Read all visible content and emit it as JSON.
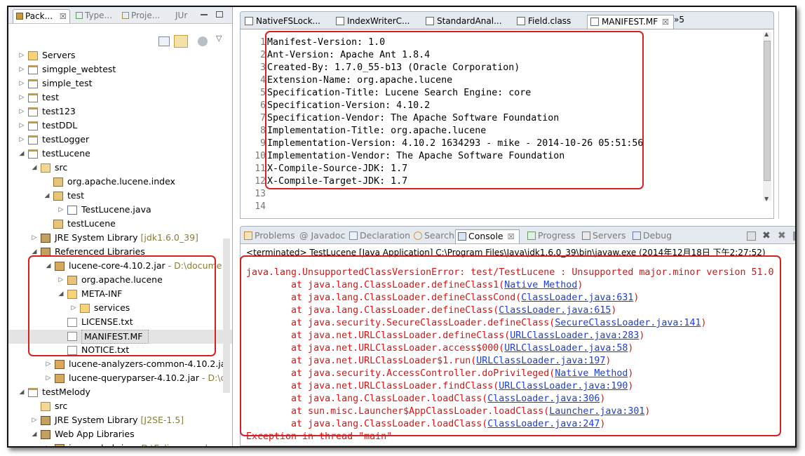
{
  "left_panel": {
    "tabs": [
      {
        "label": "Pack...",
        "close": "☒"
      },
      {
        "label": "Type...",
        "close": ""
      },
      {
        "label": "Proje...",
        "close": ""
      },
      {
        "label": "JUr",
        "close": ""
      }
    ],
    "tree": [
      {
        "label": "Servers",
        "decoration": "",
        "arrow": "▷",
        "icon": "folder-icon"
      },
      {
        "label": "simgple_webtest",
        "decoration": "",
        "arrow": "▷",
        "icon": "project-icon"
      },
      {
        "label": "simple_test",
        "decoration": "",
        "arrow": "▷",
        "icon": "project-icon"
      },
      {
        "label": "test",
        "decoration": "",
        "arrow": "▷",
        "icon": "project-icon"
      },
      {
        "label": "test123",
        "decoration": "",
        "arrow": "▷",
        "icon": "project-icon"
      },
      {
        "label": "testDDL",
        "decoration": "",
        "arrow": "▷",
        "icon": "project-icon"
      },
      {
        "label": "testLogger",
        "decoration": "",
        "arrow": "▷",
        "icon": "project-icon"
      },
      {
        "label": "testLucene",
        "decoration": "",
        "arrow": "◢",
        "icon": "project-icon"
      },
      {
        "label": "src",
        "decoration": "",
        "arrow": "◢",
        "icon": "source-folder-icon"
      },
      {
        "label": "org.apache.lucene.index",
        "decoration": "",
        "arrow": "",
        "icon": "package-icon"
      },
      {
        "label": "test",
        "decoration": "",
        "arrow": "◢",
        "icon": "package-icon"
      },
      {
        "label": "TestLucene.java",
        "decoration": "",
        "arrow": "▷",
        "icon": "java-file-icon"
      },
      {
        "label": "testLucene",
        "decoration": "",
        "arrow": "",
        "icon": "package-icon"
      },
      {
        "label": "JRE System Library",
        "decoration": "[jdk1.6.0_39]",
        "arrow": "▷",
        "icon": "library-icon"
      },
      {
        "label": "Referenced Libraries",
        "decoration": "",
        "arrow": "◢",
        "icon": "library-icon"
      },
      {
        "label": "lucene-core-4.10.2.jar",
        "decoration": "- D:\\docume",
        "arrow": "◢",
        "icon": "jar-icon"
      },
      {
        "label": "org.apache.lucene",
        "decoration": "",
        "arrow": "▷",
        "icon": "package-icon"
      },
      {
        "label": "META-INF",
        "decoration": "",
        "arrow": "◢",
        "icon": "folder-icon"
      },
      {
        "label": "services",
        "decoration": "",
        "arrow": "▷",
        "icon": "folder-icon"
      },
      {
        "label": "LICENSE.txt",
        "decoration": "",
        "arrow": "",
        "icon": "file-icon"
      },
      {
        "label": "MANIFEST.MF",
        "decoration": "",
        "arrow": "",
        "icon": "file-icon"
      },
      {
        "label": "NOTICE.txt",
        "decoration": "",
        "arrow": "",
        "icon": "file-icon"
      },
      {
        "label": "lucene-analyzers-common-4.10.2.ja",
        "decoration": "",
        "arrow": "▷",
        "icon": "jar-icon"
      },
      {
        "label": "lucene-queryparser-4.10.2.jar",
        "decoration": "- D:\\c",
        "arrow": "▷",
        "icon": "jar-icon"
      },
      {
        "label": "testMelody",
        "decoration": "",
        "arrow": "◢",
        "icon": "project-icon"
      },
      {
        "label": "src",
        "decoration": "",
        "arrow": "",
        "icon": "source-folder-icon"
      },
      {
        "label": "JRE System Library",
        "decoration": "[J2SE-1.5]",
        "arrow": "▷",
        "icon": "library-icon"
      },
      {
        "label": "Web App Libraries",
        "decoration": "",
        "arrow": "◢",
        "icon": "library-icon"
      },
      {
        "label": "javamelody.jar",
        "decoration": "- D:\\Eclipse_workspa",
        "arrow": "▷",
        "icon": "jar-icon"
      }
    ]
  },
  "editor": {
    "tabs": [
      {
        "label": "NativeFSLock..."
      },
      {
        "label": "IndexWriterC..."
      },
      {
        "label": "StandardAnal..."
      },
      {
        "label": "Field.class"
      },
      {
        "label": "MANIFEST.MF",
        "close": "☒"
      }
    ],
    "overflow": "»5",
    "lines": [
      {
        "n": "1",
        "text": "Manifest-Version: 1.0"
      },
      {
        "n": "2",
        "text": "Ant-Version: Apache Ant 1.8.4"
      },
      {
        "n": "3",
        "text": "Created-By: 1.7.0_55-b13 (Oracle Corporation)"
      },
      {
        "n": "4",
        "text": "Extension-Name: org.apache.lucene"
      },
      {
        "n": "5",
        "text": "Specification-Title: Lucene Search Engine: core"
      },
      {
        "n": "6",
        "text": "Specification-Version: 4.10.2"
      },
      {
        "n": "7",
        "text": "Specification-Vendor: The Apache Software Foundation"
      },
      {
        "n": "8",
        "text": "Implementation-Title: org.apache.lucene"
      },
      {
        "n": "9",
        "text": "Implementation-Version: 4.10.2 1634293 - mike - 2014-10-26 05:51:56"
      },
      {
        "n": "10",
        "text": "Implementation-Vendor: The Apache Software Foundation"
      },
      {
        "n": "11",
        "text": "X-Compile-Source-JDK: 1.7"
      },
      {
        "n": "12",
        "text": "X-Compile-Target-JDK: 1.7"
      },
      {
        "n": "13",
        "text": ""
      },
      {
        "n": "14",
        "text": ""
      }
    ]
  },
  "console": {
    "tabs": [
      {
        "label": "Problems"
      },
      {
        "label": "@ Javadoc"
      },
      {
        "label": "Declaration"
      },
      {
        "label": "Search"
      },
      {
        "label": "Console",
        "close": "☒"
      },
      {
        "label": "Progress"
      },
      {
        "label": "Servers"
      },
      {
        "label": "Debug"
      }
    ],
    "terminated": "<terminated> TestLucene [Java Application] C:\\Program Files\\Java\\jdk1.6.0_39\\bin\\javaw.exe (2014年12月18日 下午2:27:52)",
    "lines": [
      {
        "pre": "java.lang.UnsupportedClassVersionError: test/TestLucene : Unsupported major.minor version 51.0",
        "link": "",
        "post": ""
      },
      {
        "pre": "\tat java.lang.ClassLoader.defineClass1(",
        "link": "Native Method",
        "post": ")"
      },
      {
        "pre": "\tat java.lang.ClassLoader.defineClassCond(",
        "link": "ClassLoader.java:631",
        "post": ")"
      },
      {
        "pre": "\tat java.lang.ClassLoader.defineClass(",
        "link": "ClassLoader.java:615",
        "post": ")"
      },
      {
        "pre": "\tat java.security.SecureClassLoader.defineClass(",
        "link": "SecureClassLoader.java:141",
        "post": ")"
      },
      {
        "pre": "\tat java.net.URLClassLoader.defineClass(",
        "link": "URLClassLoader.java:283",
        "post": ")"
      },
      {
        "pre": "\tat java.net.URLClassLoader.access$000(",
        "link": "URLClassLoader.java:58",
        "post": ")"
      },
      {
        "pre": "\tat java.net.URLClassLoader$1.run(",
        "link": "URLClassLoader.java:197",
        "post": ")"
      },
      {
        "pre": "\tat java.security.AccessController.doPrivileged(",
        "link": "Native Method",
        "post": ")"
      },
      {
        "pre": "\tat java.net.URLClassLoader.findClass(",
        "link": "URLClassLoader.java:190",
        "post": ")"
      },
      {
        "pre": "\tat java.lang.ClassLoader.loadClass(",
        "link": "ClassLoader.java:306",
        "post": ")"
      },
      {
        "pre": "\tat sun.misc.Launcher$AppClassLoader.loadClass(",
        "link": "Launcher.java:301",
        "post": ")"
      },
      {
        "pre": "\tat java.lang.ClassLoader.loadClass(",
        "link": "ClassLoader.java:247",
        "post": ")"
      },
      {
        "pre": "Exception in thread \"main\"",
        "link": "",
        "post": ""
      }
    ]
  },
  "colors": {
    "error": "#dd1111",
    "link": "#1b3fd6",
    "highlight_box": "#d42020"
  }
}
